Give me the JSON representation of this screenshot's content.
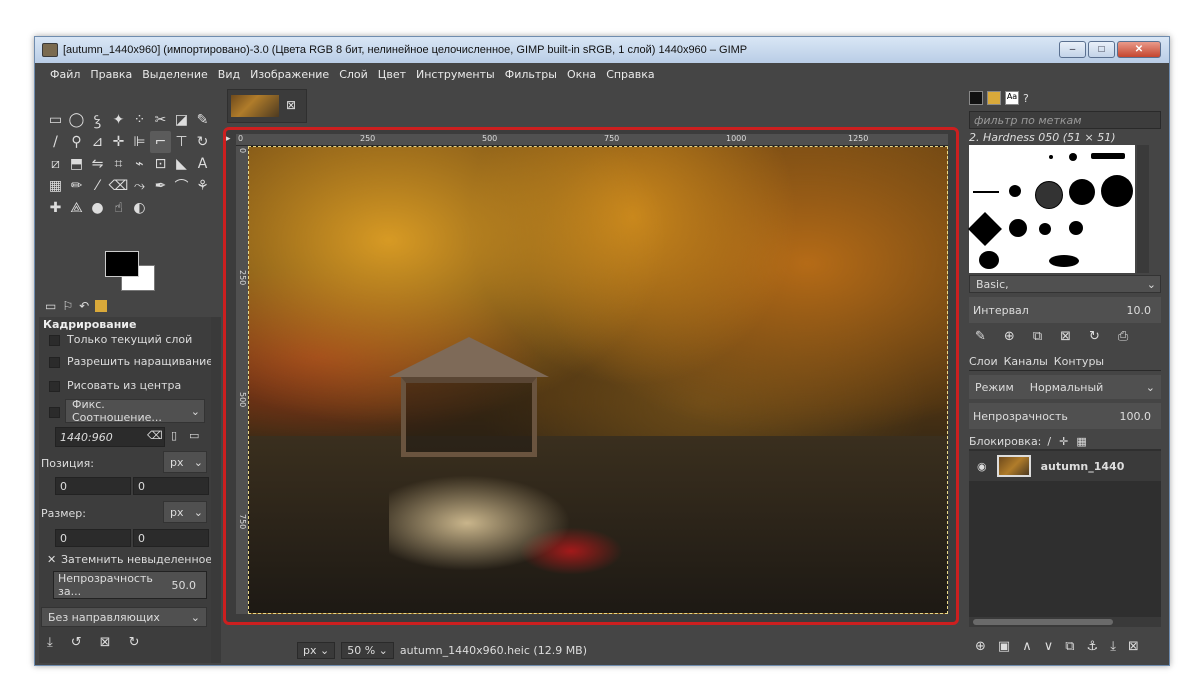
{
  "window": {
    "title": "[autumn_1440x960] (импортировано)-3.0 (Цвета RGB 8 бит, нелинейное целочисленное, GIMP built-in sRGB, 1 слой) 1440x960 – GIMP",
    "controls": {
      "minimize": "–",
      "maximize": "□",
      "close": "✕"
    }
  },
  "menu": [
    "Файл",
    "Правка",
    "Выделение",
    "Вид",
    "Изображение",
    "Слой",
    "Цвет",
    "Инструменты",
    "Фильтры",
    "Окна",
    "Справка"
  ],
  "tool_options": {
    "title": "Кадрирование",
    "only_current_layer": "Только текущий слой",
    "allow_growing": "Разрешить наращивание",
    "draw_from_center": "Рисовать из центра",
    "fixed_label": "Фикс. Соотношение...",
    "ratio": "1440:960",
    "position_label": "Позиция:",
    "position_unit": "px",
    "position_x": "0",
    "position_y": "0",
    "size_label": "Размер:",
    "size_unit": "px",
    "size_w": "0",
    "size_h": "0",
    "darken_label": "Затемнить невыделенное",
    "opacity_label": "Непрозрачность за...",
    "opacity_value": "50.0",
    "guides": "Без направляющих"
  },
  "canvas": {
    "ruler_top": [
      "0",
      "250",
      "500",
      "750",
      "1000",
      "1250"
    ],
    "ruler_left": [
      "0",
      "250",
      "500",
      "750"
    ]
  },
  "status": {
    "unit": "px",
    "zoom": "50 %",
    "file": "autumn_1440x960.heic (12.9 MB)"
  },
  "brushes": {
    "filter_placeholder": "фильтр по меткам",
    "selected_brush": "2. Hardness 050 (51 × 51)",
    "preset": "Basic,",
    "spacing_label": "Интервал",
    "spacing_value": "10.0"
  },
  "layers": {
    "tabs": [
      "Слои",
      "Каналы",
      "Контуры"
    ],
    "mode_label": "Режим",
    "mode_value": "Нормальный",
    "opacity_label": "Непрозрачность",
    "opacity_value": "100.0",
    "lock_label": "Блокировка:",
    "layer_name": "autumn_1440"
  },
  "colors": {
    "accent_red": "#cc1f1f",
    "bg_panel": "#454545"
  }
}
